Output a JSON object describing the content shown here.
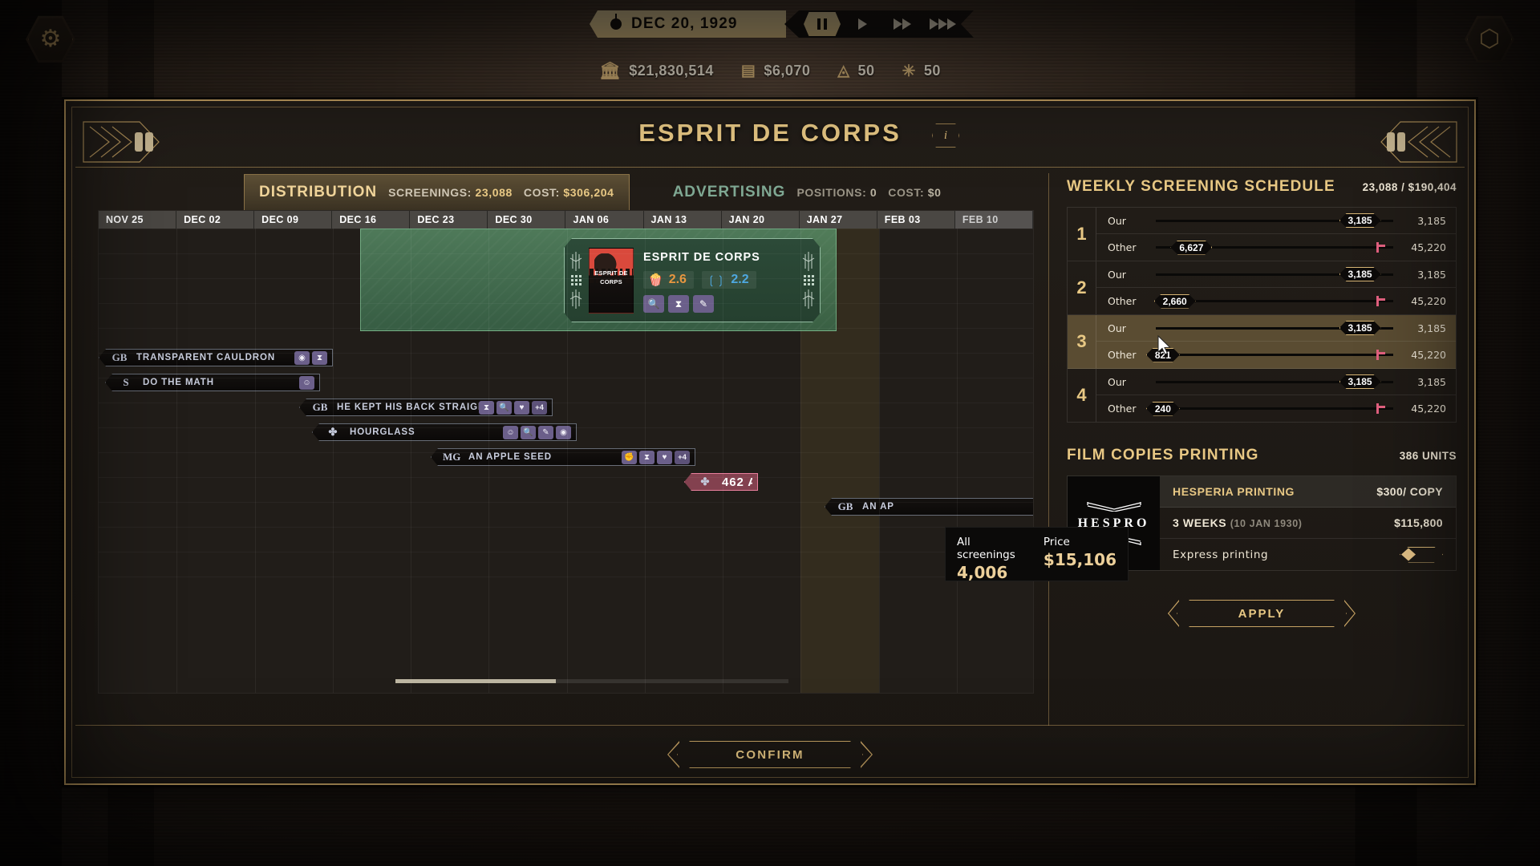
{
  "topbar": {
    "settings_icon": "gear-icon",
    "right_icon": "hex-icon",
    "date": "DEC 20, 1929",
    "speed": {
      "pause": "❙❙",
      "play": "▶",
      "fast": "▶▶",
      "fastest": "▶▶▶"
    },
    "resources": [
      {
        "icon": "bank-icon",
        "value": "$21,830,514"
      },
      {
        "icon": "money-stack-icon",
        "value": "$6,070"
      },
      {
        "icon": "eye-pyramid-icon",
        "value": "50"
      },
      {
        "icon": "star-burst-icon",
        "value": "50"
      }
    ]
  },
  "window": {
    "title": "ESPRIT DE CORPS",
    "info_label": "i",
    "confirm_label": "CONFIRM"
  },
  "tabs": [
    {
      "name": "DISTRIBUTION",
      "active": true,
      "stats": [
        {
          "label": "SCREENINGS:",
          "value": "23,088"
        },
        {
          "label": "COST:",
          "value": "$306,204"
        }
      ]
    },
    {
      "name": "ADVERTISING",
      "active": false,
      "stats": [
        {
          "label": "POSITIONS:",
          "value": "0"
        },
        {
          "label": "COST:",
          "value": "$0"
        }
      ]
    }
  ],
  "timeline": {
    "columns": [
      "NOV 25",
      "DEC 02",
      "DEC 09",
      "DEC 16",
      "DEC 23",
      "DEC 30",
      "JAN 06",
      "JAN 13",
      "JAN 20",
      "JAN 27",
      "FEB 03",
      "FEB 10"
    ],
    "dimmed_column": "FEB 10",
    "playhead_column": "DEC 23",
    "film_card": {
      "title": "ESPRIT DE CORPS",
      "poster_text": "ESPRIT DE CORPS",
      "popularity": "2.6",
      "critics": "2.2",
      "actions": [
        "magnifier-icon",
        "hourglass-icon",
        "pen-icon"
      ]
    },
    "tooltip": {
      "screenings_label": "All screenings",
      "screenings_value": "4,006",
      "price_label": "Price",
      "price_value": "$15,106"
    },
    "competitor_films": [
      {
        "studio": "GB",
        "name": "TRANSPARENT CAULDRON",
        "tags": [
          "compass-icon",
          "hourglass-icon"
        ],
        "extra": ""
      },
      {
        "studio": "S",
        "name": "DO THE MATH",
        "tags": [
          "mask-icon"
        ],
        "extra": ""
      },
      {
        "studio": "GB",
        "name": "HE KEPT HIS BACK STRAIGHT",
        "tags": [
          "hourglass-icon",
          "magnifier-icon",
          "heart-icon"
        ],
        "extra": "+4"
      },
      {
        "studio": "✤",
        "name": "HOURGLASS",
        "tags": [
          "mask-icon",
          "magnifier-icon",
          "pen-icon",
          "compass-icon"
        ],
        "extra": ""
      },
      {
        "studio": "MG",
        "name": "AN APPLE SEED",
        "tags": [
          "fist-icon",
          "hourglass-icon",
          "heart-icon"
        ],
        "extra": "+4"
      },
      {
        "studio": "✤",
        "name": "462",
        "name_ghost": "APPLE SEED",
        "tags": [],
        "extra": "",
        "highlight": true
      },
      {
        "studio": "GB",
        "name": "AN AP",
        "tags": [],
        "extra": ""
      }
    ]
  },
  "schedule": {
    "heading": "WEEKLY SCREENING SCHEDULE",
    "summary": "23,088 / $190,404",
    "row_labels": {
      "our": "Our",
      "other": "Other"
    },
    "weeks": [
      {
        "num": "1",
        "selected": false,
        "our": {
          "knob": "3,185",
          "total": "3,185",
          "pct": 86
        },
        "other": {
          "knob": "6,627",
          "total": "45,220",
          "pct": 15
        }
      },
      {
        "num": "2",
        "selected": false,
        "our": {
          "knob": "3,185",
          "total": "3,185",
          "pct": 86
        },
        "other": {
          "knob": "2,660",
          "total": "45,220",
          "pct": 8
        }
      },
      {
        "num": "3",
        "selected": true,
        "our": {
          "knob": "3,185",
          "total": "3,185",
          "pct": 86
        },
        "other": {
          "knob": "821",
          "total": "45,220",
          "pct": 3
        }
      },
      {
        "num": "4",
        "selected": false,
        "our": {
          "knob": "3,185",
          "total": "3,185",
          "pct": 86
        },
        "other": {
          "knob": "240",
          "total": "45,220",
          "pct": 3
        }
      }
    ]
  },
  "printing": {
    "heading": "FILM COPIES PRINTING",
    "units": "386 UNITS",
    "logo_text": "HESPRO",
    "company": "HESPERIA PRINTING",
    "price_per_copy": "$300/ COPY",
    "duration": "3 WEEKS",
    "duration_date": "(10 JAN 1930)",
    "total_cost": "$115,800",
    "express_label": "Express printing",
    "apply_label": "APPLY"
  },
  "colors": {
    "gold": "#e8c884",
    "frame": "#c6a263",
    "green_block": "#3a684a",
    "pink": "#e2607f",
    "teal_tab": "#7fa893"
  }
}
